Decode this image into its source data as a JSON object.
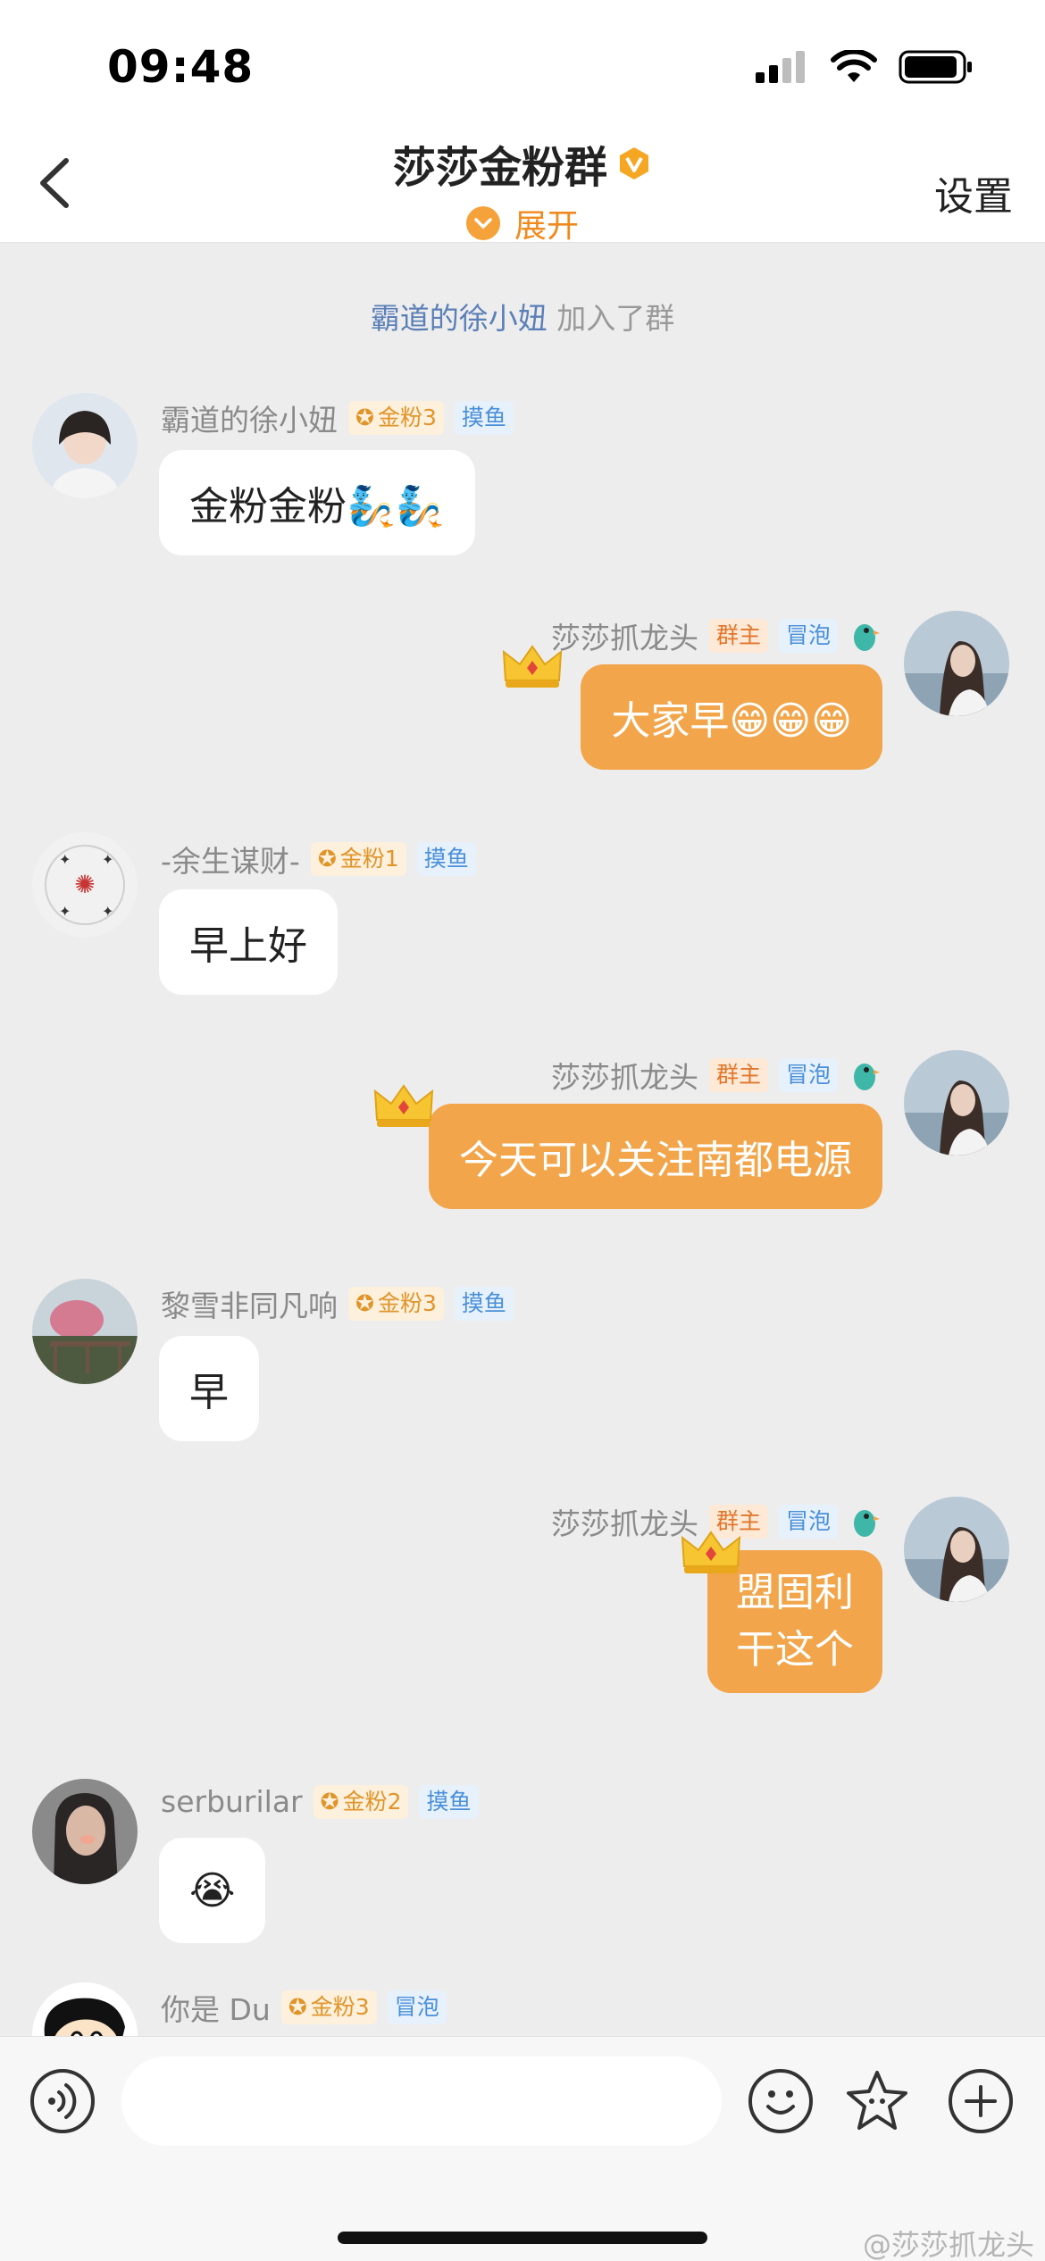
{
  "status": {
    "time": "09:48"
  },
  "nav": {
    "title": "莎莎金粉群",
    "expand_label": "展开",
    "settings_label": "设置"
  },
  "system": {
    "user": "霸道的徐小妞",
    "action": "加入了群"
  },
  "messages": [
    {
      "name": "霸道的徐小妞",
      "badge": "金粉3",
      "tag": "摸鱼",
      "text": "金粉金粉🧞🧞"
    },
    {
      "name": "莎莎抓龙头",
      "owner_tag": "群主",
      "tag": "冒泡",
      "text": "大家早😁😁😁"
    },
    {
      "name": "-余生谋财-",
      "badge": "金粉1",
      "tag": "摸鱼",
      "text": "早上好"
    },
    {
      "name": "莎莎抓龙头",
      "owner_tag": "群主",
      "tag": "冒泡",
      "text": "今天可以关注南都电源"
    },
    {
      "name": "黎雪非同凡响",
      "badge": "金粉3",
      "tag": "摸鱼",
      "text": "早"
    },
    {
      "name": "莎莎抓龙头",
      "owner_tag": "群主",
      "tag": "冒泡",
      "text_line1": "盟固利",
      "text_line2": "干这个"
    },
    {
      "name": "serburilar",
      "badge": "金粉2",
      "tag": "摸鱼",
      "text": "😭"
    },
    {
      "name": "你是 Du",
      "badge": "金粉3",
      "tag": "冒泡"
    }
  ],
  "input": {
    "placeholder": ""
  },
  "icons": [
    "back-icon",
    "vip-badge-icon",
    "chevron-down-icon",
    "voice-icon",
    "emoji-icon",
    "star-sticker-icon",
    "plus-icon",
    "crown-icon",
    "bird-icon",
    "signal-icon",
    "wifi-icon",
    "battery-icon"
  ],
  "watermark": "@莎莎抓龙头",
  "colors": {
    "accent": "#f2a54a",
    "link": "#5b7fb7",
    "gold_badge": "#e0952a",
    "fish_tag": "#4a90d9"
  }
}
